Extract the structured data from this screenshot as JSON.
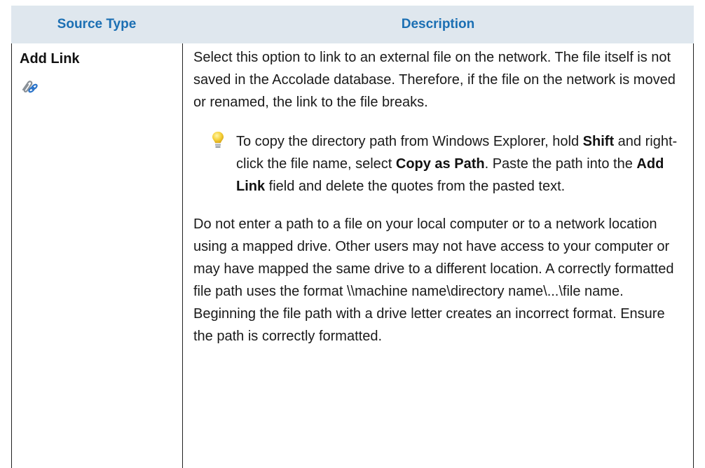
{
  "table": {
    "header": {
      "source_type": "Source Type",
      "description": "Description"
    },
    "row": {
      "type_label": "Add Link",
      "type_icon": "paperclip-link-icon",
      "para1": "Select this option to link to an external file on the network. The file itself is not saved in the Accolade database. Therefore, if the file on the network is moved or renamed, the link to the file breaks.",
      "tip": {
        "icon": "lightbulb-icon",
        "t1": "To copy the directory path from Windows Explorer, hold ",
        "b1": "Shift",
        "t2": " and right-click the file name, select ",
        "b2": "Copy as Path",
        "t3": ". Paste the path into the ",
        "b3": "Add Link",
        "t4": " field and delete the quotes from the pasted text."
      },
      "para2": "Do not enter a path to a file on your local computer or to a network location using a mapped drive. Other users may not have access to your computer or may have mapped the same drive to a different location. A correctly formatted file path uses the format \\\\machine name\\directory name\\...\\file name. Beginning the file path with a drive letter creates an incorrect format. Ensure the path is correctly formatted."
    }
  },
  "colors": {
    "header_bg": "#dfe7ee",
    "header_text": "#1b6fb3",
    "border": "#222222"
  }
}
